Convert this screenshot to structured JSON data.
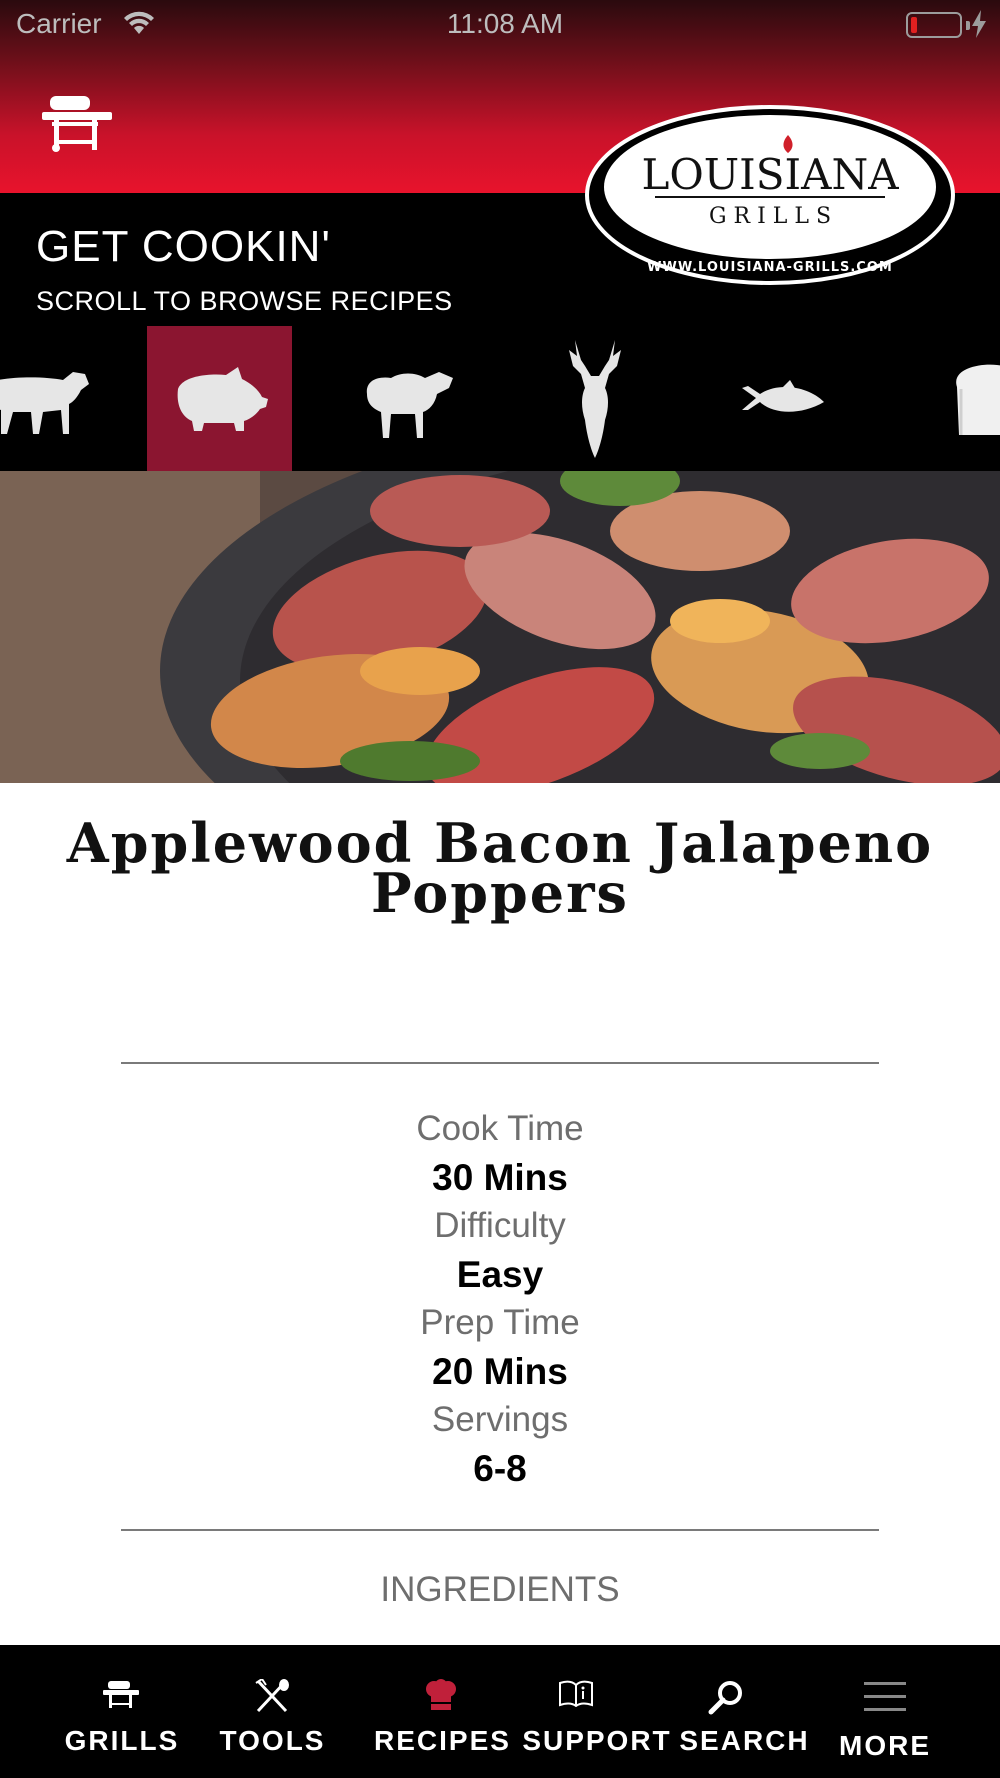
{
  "status_bar": {
    "carrier": "Carrier",
    "time": "11:08 AM"
  },
  "header": {
    "title": "GET COOKIN'",
    "subtitle": "SCROLL TO BROWSE RECIPES",
    "logo": {
      "name": "LOUISIANA",
      "sub": "G R I L L S",
      "url": "WWW.LOUISIANA-GRILLS.COM"
    }
  },
  "categories": [
    {
      "icon": "cow-icon",
      "active": false
    },
    {
      "icon": "pig-icon",
      "active": true
    },
    {
      "icon": "sheep-icon",
      "active": false
    },
    {
      "icon": "deer-icon",
      "active": false
    },
    {
      "icon": "fish-icon",
      "active": false
    },
    {
      "icon": "bread-icon",
      "active": false
    }
  ],
  "recipe": {
    "title_line1": "Applewood Bacon Jalapeno",
    "title_line2": "Poppers",
    "stats": [
      {
        "label": "Cook Time",
        "value": "30 Mins"
      },
      {
        "label": "Difficulty",
        "value": "Easy"
      },
      {
        "label": "Prep Time",
        "value": "20 Mins"
      },
      {
        "label": "Servings",
        "value": "6-8"
      }
    ],
    "ingredients_heading": "INGREDIENTS"
  },
  "tabbar": {
    "tabs": [
      {
        "label": "GRILLS",
        "icon": "grill-icon"
      },
      {
        "label": "TOOLS",
        "icon": "utensils-icon"
      },
      {
        "label": "RECIPES",
        "icon": "chef-hat-icon"
      },
      {
        "label": "SUPPORT",
        "icon": "book-icon"
      },
      {
        "label": "SEARCH",
        "icon": "search-icon"
      },
      {
        "label": "MORE",
        "icon": "menu-icon"
      }
    ]
  },
  "colors": {
    "brand_red": "#e8132c",
    "active_category": "#8b1530",
    "recipes_icon": "#c0203a"
  }
}
